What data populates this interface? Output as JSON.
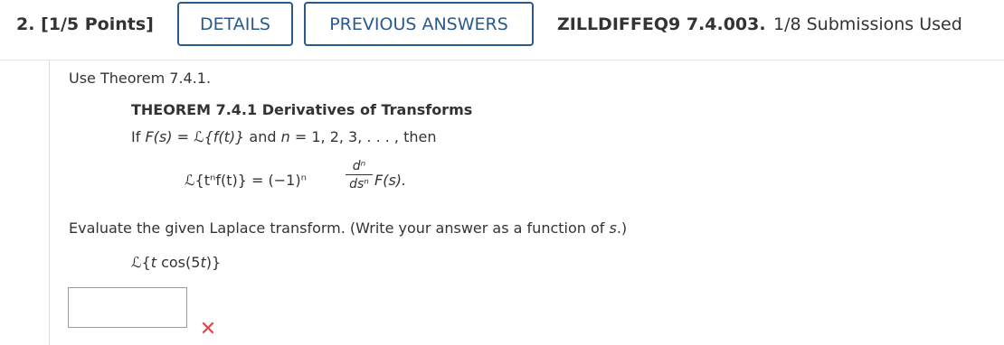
{
  "header": {
    "question_number": "2.",
    "points": "[1/5 Points]",
    "details_label": "DETAILS",
    "previous_answers_label": "PREVIOUS ANSWERS",
    "problem_code": "ZILLDIFFEQ9 7.4.003.",
    "submissions": "1/8 Submissions Used"
  },
  "problem": {
    "instruction": "Use Theorem 7.4.1.",
    "theorem_title": "THEOREM 7.4.1 Derivatives of Transforms",
    "theorem_if": "If",
    "theorem_Fs": "F(s)",
    "theorem_eq": " = ",
    "theorem_L": "ℒ",
    "theorem_ft": "{f(t)}",
    "theorem_and": " and ",
    "theorem_n": "n",
    "theorem_values": " = 1, 2, 3, . . . , then",
    "formula_lhs": "ℒ{tⁿf(t)} = (−1)ⁿ",
    "formula_num": "dⁿ",
    "formula_den": "dsⁿ",
    "formula_rhs": "F(s).",
    "evaluate_prefix": "Evaluate the given Laplace transform. (Write your answer as a function of ",
    "evaluate_var": "s",
    "evaluate_suffix": ".)",
    "transform_L": "ℒ",
    "transform_open": "{",
    "transform_t": "t",
    "transform_cos": " cos(5",
    "transform_t2": "t",
    "transform_close": ")}"
  },
  "answer": {
    "value": "",
    "status_icon": "x-mark-icon",
    "status_color": "#e0464b"
  },
  "colors": {
    "accent": "#2a5a8c",
    "text": "#333333"
  }
}
